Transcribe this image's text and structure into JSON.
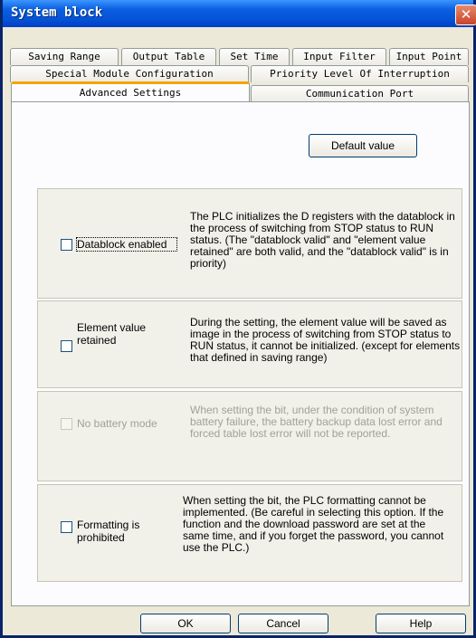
{
  "window": {
    "title": "System block",
    "close_glyph": "✕"
  },
  "tabs": {
    "row1": [
      "Saving Range",
      "Output Table",
      "Set Time",
      "Input Filter",
      "Input Point"
    ],
    "row2": [
      "Special Module Configuration",
      "Priority Level Of Interruption"
    ],
    "row3": [
      "Advanced Settings",
      "Communication Port"
    ],
    "selected": "Advanced Settings"
  },
  "default_value_button": "Default value",
  "options": [
    {
      "label": "Datablock enabled",
      "checked": false,
      "enabled": true,
      "description": "The PLC initializes the D registers with the datablock in the process of switching from STOP status to RUN status. (The \"datablock valid\" and \"element value retained\" are both valid, and the \"datablock valid\" is in priority)"
    },
    {
      "label": "Element value retained",
      "checked": false,
      "enabled": true,
      "description": "During the setting, the element value will be saved as image in the process of switching from STOP status to RUN status, it cannot be initialized. (except for elements that defined in saving range)"
    },
    {
      "label": "No battery mode",
      "checked": false,
      "enabled": false,
      "description": "When setting the bit, under the condition of system battery failure, the battery backup data lost error and forced table lost error will not be reported."
    },
    {
      "label": "Formatting is prohibited",
      "checked": false,
      "enabled": true,
      "description": "When setting the bit, the PLC formatting cannot be implemented. (Be careful in selecting this option. If the function and the download password are set at the same time, and if you forget the password, you cannot use the PLC.)"
    }
  ],
  "footer": {
    "ok": "OK",
    "cancel": "Cancel",
    "help": "Help"
  },
  "colors": {
    "title_bar": "#0a5fe0",
    "tab_highlight": "#f4a500",
    "dialog_bg": "#ece9d8"
  }
}
